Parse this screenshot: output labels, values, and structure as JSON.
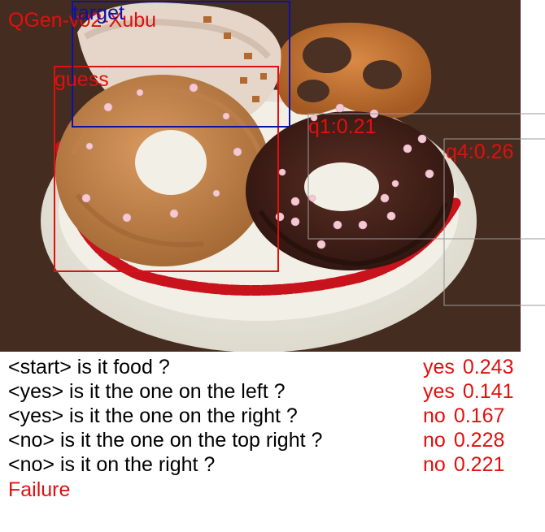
{
  "overlay": {
    "model_label": "QGen-v02-Xubu",
    "target_label": "target",
    "guess_label": "guess",
    "q1_label": "q1:0.21",
    "right_label": "q4:0.26"
  },
  "colors": {
    "red": "#e0100f",
    "blue": "#0b12a8",
    "gray": "#9a9a9a"
  },
  "dialog": [
    {
      "question": "<start> is it food ?",
      "answer": "yes",
      "score": "0.243"
    },
    {
      "question": "<yes> is it the one on the left ?",
      "answer": "yes",
      "score": "0.141"
    },
    {
      "question": "<yes> is it the one on the right ?",
      "answer": "no",
      "score": "0.167"
    },
    {
      "question": "<no> is it the one on the top right ?",
      "answer": "no",
      "score": "0.228"
    },
    {
      "question": "<no> is it on the right ?",
      "answer": "no",
      "score": "0.221"
    }
  ],
  "result": "Failure"
}
